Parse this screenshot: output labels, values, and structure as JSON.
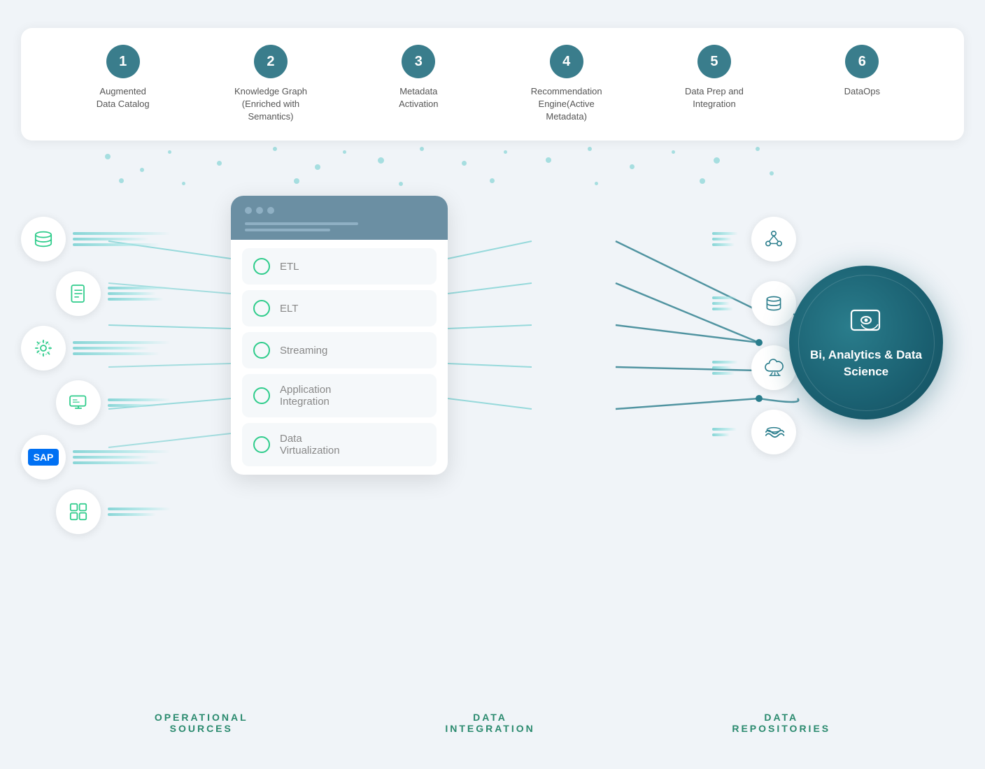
{
  "top_items": [
    {
      "number": "1",
      "label": "Augmented\nData Catalog"
    },
    {
      "number": "2",
      "label": "Knowledge Graph\n(Enriched with\nSemantics)"
    },
    {
      "number": "3",
      "label": "Metadata\nActivation"
    },
    {
      "number": "4",
      "label": "Recommendation\nEngine(Active\nMetadata)"
    },
    {
      "number": "5",
      "label": "Data Prep and\nIntegration"
    },
    {
      "number": "6",
      "label": "DataOps"
    }
  ],
  "integration_items": [
    {
      "id": "etl",
      "label": "ETL"
    },
    {
      "id": "elt",
      "label": "ELT"
    },
    {
      "id": "streaming",
      "label": "Streaming"
    },
    {
      "id": "app-integration",
      "label": "Application\nIntegration"
    },
    {
      "id": "data-virt",
      "label": "Data\nVirtualization"
    }
  ],
  "bottom_labels": [
    {
      "id": "operational",
      "line1": "OPERATIONAL",
      "line2": "SOURCES"
    },
    {
      "id": "data-integration",
      "line1": "DATA",
      "line2": "INTEGRATION"
    },
    {
      "id": "repositories",
      "line1": "DATA",
      "line2": "REPOSITORIES"
    }
  ],
  "bi_circle": {
    "title": "Bi, Analytics\n& Data Science"
  },
  "colors": {
    "teal": "#2a7d8c",
    "green": "#2ecc8b",
    "light_teal": "#5bc8c8"
  }
}
